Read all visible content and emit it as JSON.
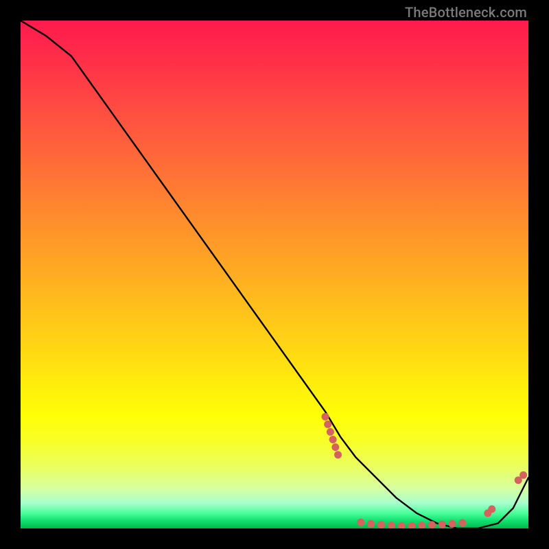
{
  "watermark": "TheBottleneck.com",
  "chart_data": {
    "type": "line",
    "title": "",
    "xlabel": "",
    "ylabel": "",
    "xlim": [
      0,
      100
    ],
    "ylim": [
      0,
      100
    ],
    "series": [
      {
        "name": "curve",
        "x": [
          0,
          5,
          10,
          15,
          20,
          25,
          30,
          35,
          40,
          45,
          50,
          55,
          60,
          63,
          66,
          70,
          74,
          78,
          82,
          86,
          90,
          94,
          97,
          100
        ],
        "y": [
          100,
          97,
          93,
          86,
          79,
          72,
          65,
          58,
          51,
          44,
          37,
          30,
          23,
          18,
          14,
          10,
          6,
          3,
          1,
          0,
          0,
          1,
          4,
          10
        ]
      }
    ],
    "scatter_clusters": [
      {
        "name": "cluster-left",
        "points": [
          [
            60,
            22
          ],
          [
            60.5,
            20.5
          ],
          [
            61,
            19
          ],
          [
            61.5,
            17.5
          ],
          [
            62,
            16
          ],
          [
            62.5,
            14.5
          ]
        ]
      },
      {
        "name": "cluster-bottom",
        "points": [
          [
            67,
            1.2
          ],
          [
            69,
            0.9
          ],
          [
            71,
            0.7
          ],
          [
            73,
            0.6
          ],
          [
            75,
            0.5
          ],
          [
            77,
            0.5
          ],
          [
            79,
            0.6
          ],
          [
            81,
            0.7
          ],
          [
            83,
            0.8
          ],
          [
            85,
            0.9
          ],
          [
            87,
            1.1
          ]
        ]
      },
      {
        "name": "cluster-right",
        "points": [
          [
            92,
            3.0
          ],
          [
            92.8,
            3.8
          ],
          [
            98,
            9.5
          ],
          [
            99,
            10.5
          ]
        ]
      }
    ],
    "colors": {
      "curve": "#000000",
      "dots": "#d4635f"
    }
  }
}
